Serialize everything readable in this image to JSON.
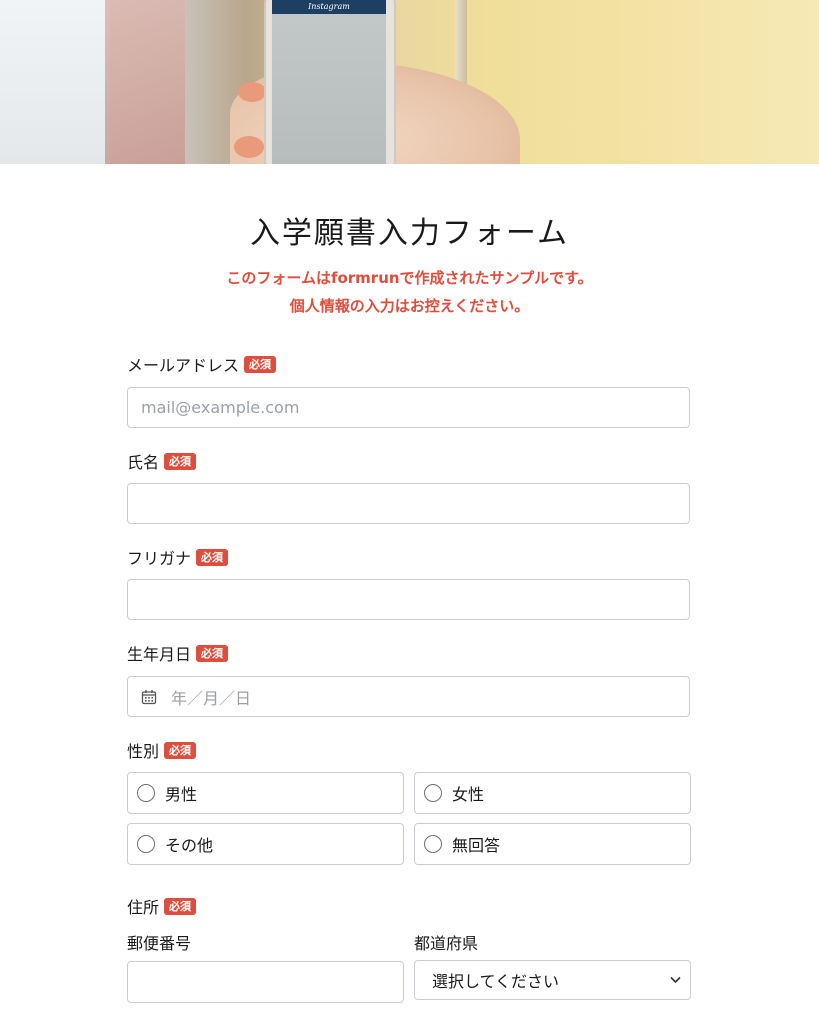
{
  "hero": {
    "phone_app": "Instagram"
  },
  "form": {
    "title": "入学願書入力フォーム",
    "notice_line1": "このフォームはformrunで作成されたサンプルです。",
    "notice_line2": "個人情報の入力はお控えください。",
    "required_badge": "必須"
  },
  "fields": {
    "email": {
      "label": "メールアドレス",
      "placeholder": "mail@example.com"
    },
    "name": {
      "label": "氏名",
      "value": ""
    },
    "furigana": {
      "label": "フリガナ",
      "value": ""
    },
    "birthdate": {
      "label": "生年月日",
      "placeholder": "年／月／日"
    },
    "gender": {
      "label": "性別",
      "options": [
        "男性",
        "女性",
        "その他",
        "無回答"
      ]
    },
    "address": {
      "label": "住所",
      "postal_label": "郵便番号",
      "prefecture_label": "都道府県",
      "prefecture_selected": "選択してください"
    }
  },
  "colors": {
    "accent": "#dc4f3e",
    "border": "#c9cdd2"
  },
  "icons": {
    "calendar": "calendar-icon",
    "select_arrow": "chevron-down-icon"
  }
}
